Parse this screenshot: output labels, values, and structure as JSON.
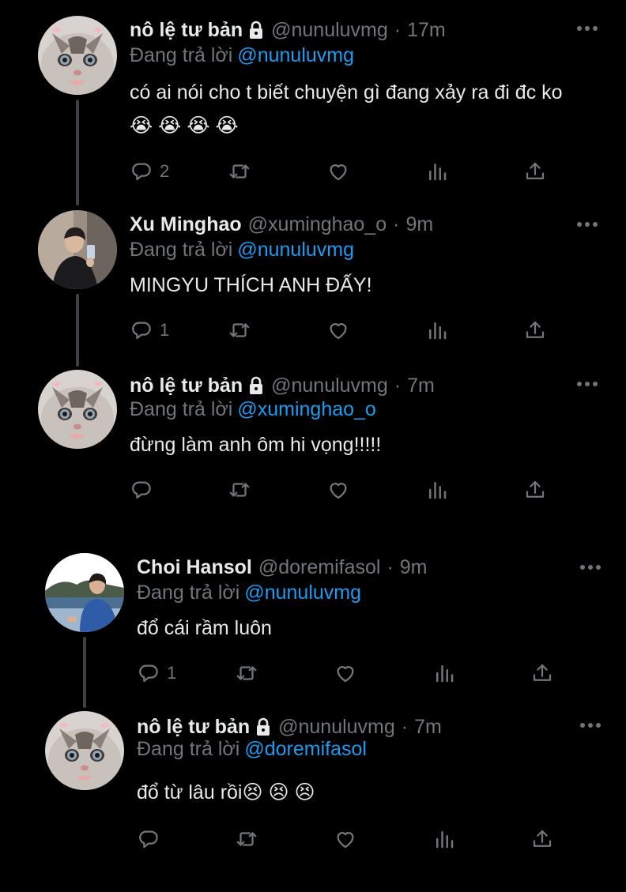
{
  "tweets": [
    {
      "name": "nô lệ tư bản",
      "locked": true,
      "handle": "@nunuluvmg",
      "time": "17m",
      "reply_label": "Đang trả lời",
      "reply_to": "@nunuluvmg",
      "text": "có ai nói cho t biết chuyện gì đang xảy ra đi đc ko😭 😭 😭 😭",
      "replies": "2",
      "avatar": "cat-avatar"
    },
    {
      "name": "Xu Minghao",
      "locked": false,
      "handle": "@xuminghao_o",
      "time": "9m",
      "reply_label": "Đang trả lời",
      "reply_to": "@nunuluvmg",
      "text": "MINGYU THÍCH ANH ĐẤY!",
      "replies": "1",
      "avatar": "person-avatar"
    },
    {
      "name": "nô lệ tư bản",
      "locked": true,
      "handle": "@nunuluvmg",
      "time": "7m",
      "reply_label": "Đang trả lời",
      "reply_to": "@xuminghao_o",
      "text": "đừng làm anh ôm hi vọng!!!!!",
      "replies": "",
      "avatar": "cat-avatar"
    },
    {
      "name": "Choi Hansol",
      "locked": false,
      "handle": "@doremifasol",
      "time": "9m",
      "reply_label": "Đang trả lời",
      "reply_to": "@nunuluvmg",
      "text": "đổ cái rầm luôn",
      "replies": "1",
      "avatar": "person-lake-avatar"
    },
    {
      "name": "nô lệ tư bản",
      "locked": true,
      "handle": "@nunuluvmg",
      "time": "7m",
      "reply_label": "Đang trả lời",
      "reply_to": "@doremifasol",
      "text": "đổ từ lâu rồi😣 😣 😣",
      "replies": "",
      "avatar": "cat-avatar"
    }
  ],
  "icons": {
    "reply": "reply-icon",
    "retweet": "retweet-icon",
    "like": "heart-icon",
    "views": "analytics-icon",
    "share": "share-icon",
    "lock": "lock-icon",
    "more": "more-icon"
  },
  "colors": {
    "background": "#000000",
    "text": "#e7e9ea",
    "secondary": "#71767b",
    "link": "#1d9bf0"
  }
}
